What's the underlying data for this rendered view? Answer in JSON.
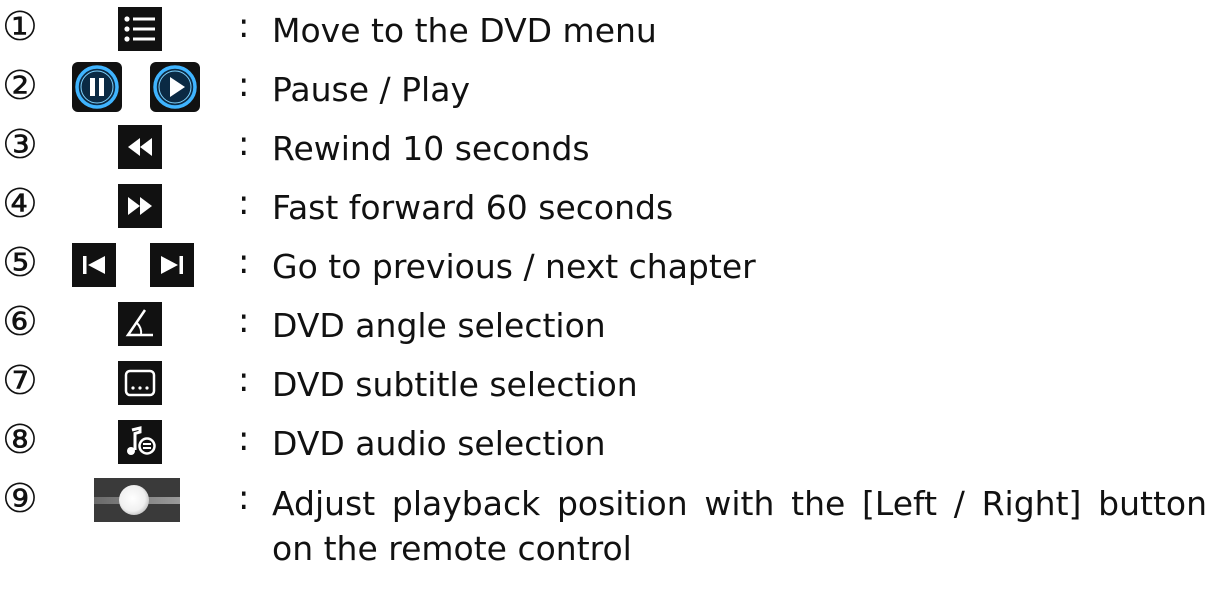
{
  "items": [
    {
      "num": "①",
      "description": "Move to the DVD menu",
      "icons": [
        "menu-list-icon"
      ]
    },
    {
      "num": "②",
      "description": "Pause / Play",
      "icons": [
        "pause-icon",
        "play-icon"
      ]
    },
    {
      "num": "③",
      "description": "Rewind 10 seconds",
      "icons": [
        "rewind-icon"
      ]
    },
    {
      "num": "④",
      "description": "Fast forward 60 seconds",
      "icons": [
        "fast-forward-icon"
      ]
    },
    {
      "num": "⑤",
      "description": "Go to previous / next chapter",
      "icons": [
        "previous-chapter-icon",
        "next-chapter-icon"
      ]
    },
    {
      "num": "⑥",
      "description": "DVD angle selection",
      "icons": [
        "angle-icon"
      ]
    },
    {
      "num": "⑦",
      "description": "DVD subtitle selection",
      "icons": [
        "subtitle-icon"
      ]
    },
    {
      "num": "⑧",
      "description": "DVD audio selection",
      "icons": [
        "audio-icon"
      ]
    },
    {
      "num": "⑨",
      "description": "Adjust playback position with the [Left / Right] button on the remote control",
      "icons": [
        "seek-slider-icon"
      ]
    }
  ],
  "separator": ":",
  "colors": {
    "icon_background": "#111111",
    "icon_glyph": "#ffffff",
    "play_pause_accent": "#3fb4ff"
  }
}
